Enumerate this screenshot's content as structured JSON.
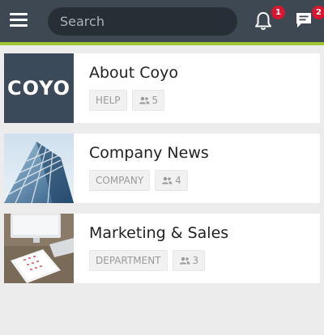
{
  "header": {
    "search_placeholder": "Search",
    "notifications_count": "1",
    "messages_count": "2"
  },
  "pages": [
    {
      "title": "About Coyo",
      "category": "HELP",
      "members": "5",
      "thumb_text": "COYO"
    },
    {
      "title": "Company News",
      "category": "COMPANY",
      "members": "4"
    },
    {
      "title": "Marketing & Sales",
      "category": "DEPARTMENT",
      "members": "3"
    }
  ],
  "colors": {
    "topbar": "#3d4852",
    "accent": "#a0c437",
    "badge": "#d7172f"
  }
}
